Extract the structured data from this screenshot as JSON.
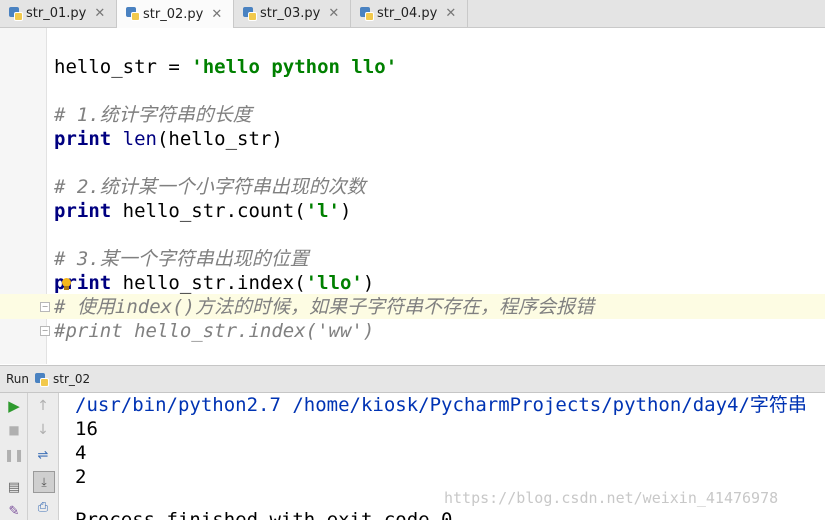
{
  "tabs": [
    {
      "label": "str_01.py",
      "active": false
    },
    {
      "label": "str_02.py",
      "active": true
    },
    {
      "label": "str_03.py",
      "active": false
    },
    {
      "label": "str_04.py",
      "active": false
    }
  ],
  "editor": {
    "lines": {
      "l1": {
        "var": "hello_str",
        "op": " = ",
        "str": "'hello python llo'"
      },
      "l2": {
        "comment": "# 1.统计字符串的长度"
      },
      "l3": {
        "kw": "print",
        "sp": " ",
        "fn": "len",
        "rest": "(hello_str)"
      },
      "l4": {
        "comment": "# 2.统计某一个小字符串出现的次数"
      },
      "l5": {
        "kw": "print",
        "rest1": " hello_str.count(",
        "str": "'l'",
        "rest2": ")"
      },
      "l6": {
        "comment": "# 3.某一个字符串出现的位置"
      },
      "l7": {
        "kw": "print",
        "rest1": " hello_str.index(",
        "str": "'llo'",
        "rest2": ")"
      },
      "l8": {
        "comment": "# 使用index()方法的时候，如果子字符串不存在，程序会报错"
      },
      "l9": {
        "comment": "#print hello_str.index('ww')"
      }
    }
  },
  "run_panel": {
    "label": "Run",
    "config_name": "str_02",
    "output": {
      "command": "/usr/bin/python2.7 /home/kiosk/PycharmProjects/python/day4/字符串",
      "line1": "16",
      "line2": "4",
      "line3": "2",
      "finish": "Process finished with exit code 0"
    }
  },
  "watermark": "https://blog.csdn.net/weixin_41476978",
  "colors": {
    "keyword": "#000080",
    "string": "#008000",
    "comment": "#808080",
    "highlight": "#fdfce3"
  }
}
